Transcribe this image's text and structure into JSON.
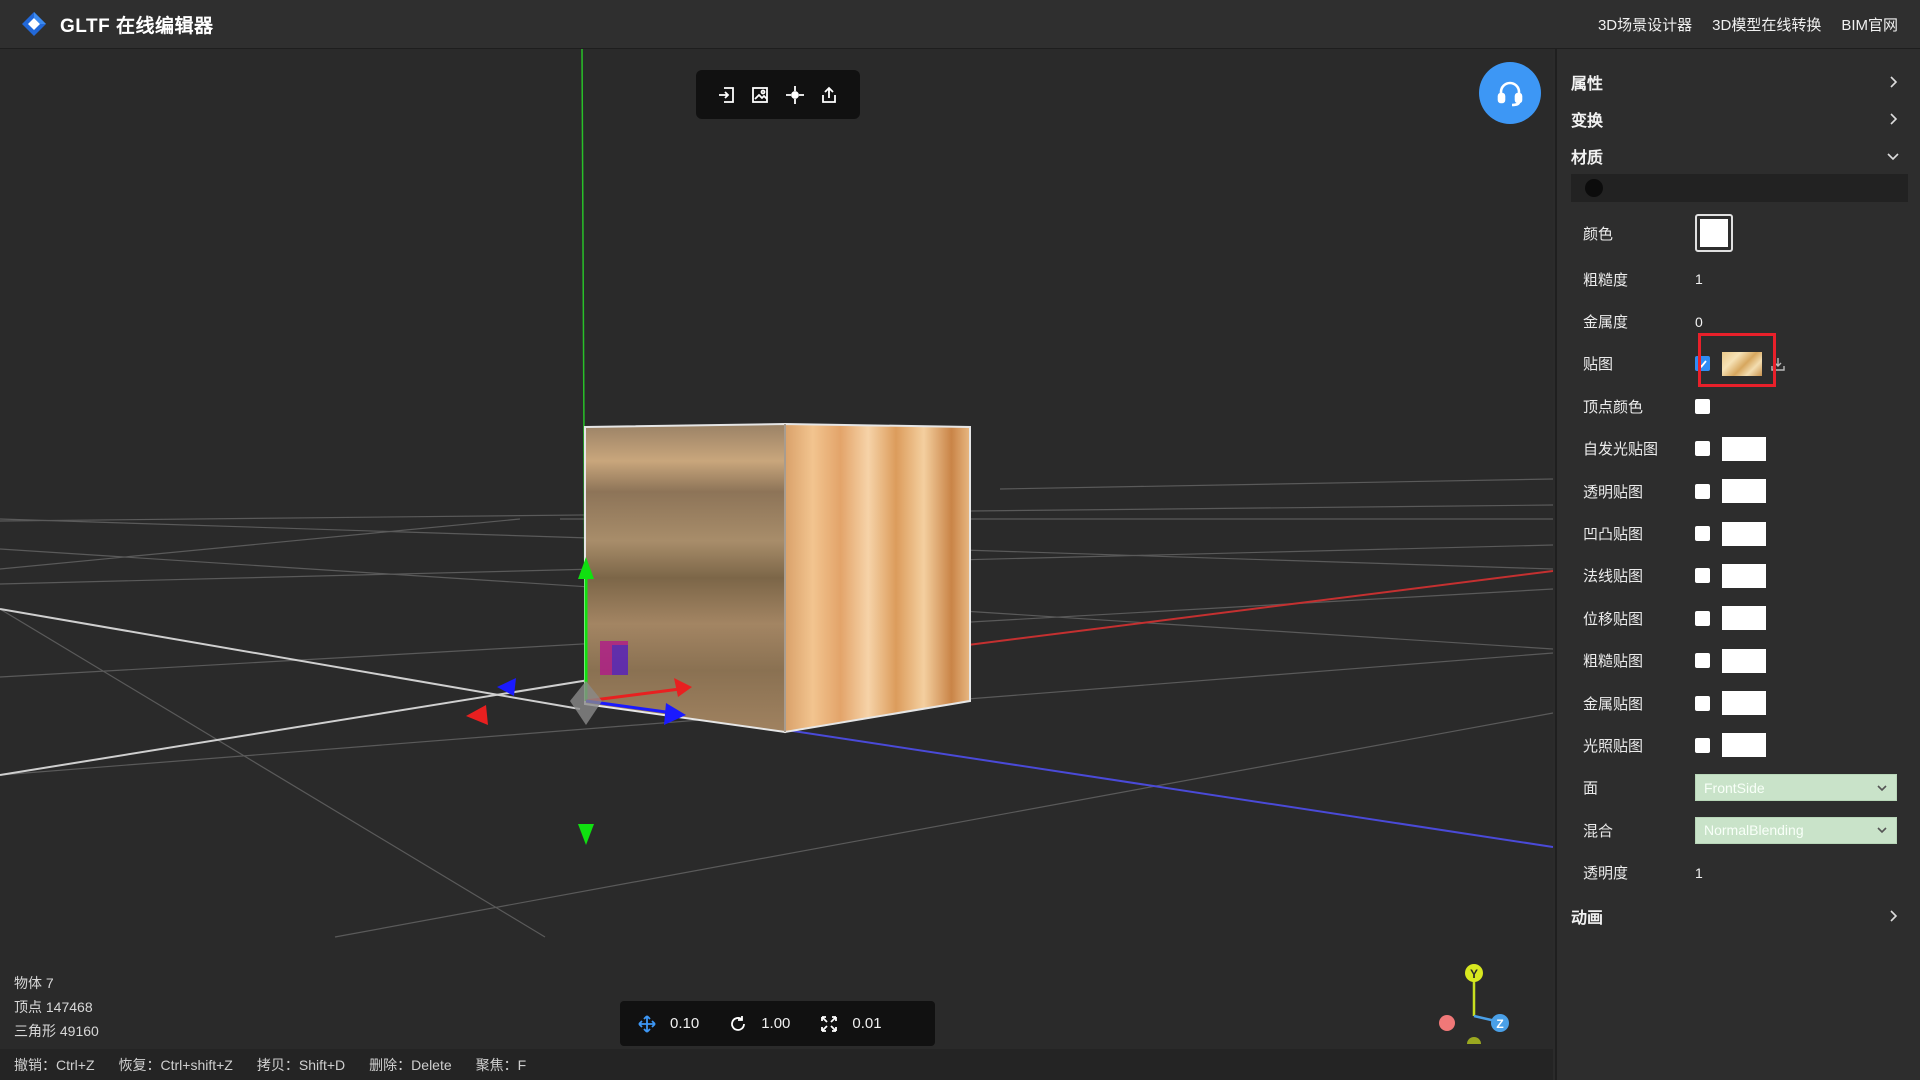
{
  "app": {
    "title": "GLTF 在线编辑器",
    "links": [
      "3D场景设计器",
      "3D模型在线转换",
      "BIM官网"
    ]
  },
  "stats": {
    "objects": "物体 7",
    "vertices": "顶点 147468",
    "triangles": "三角形 49160"
  },
  "snap": {
    "translate": "0.10",
    "rotate": "1.00",
    "scale": "0.01"
  },
  "shortcuts": [
    "撤销：Ctrl+Z",
    "恢复：Ctrl+shift+Z",
    "拷贝：Shift+D",
    "删除：Delete",
    "聚焦：F"
  ],
  "gizmo": {
    "x": "",
    "y": "Y",
    "z": "Z"
  },
  "panel": {
    "properties": "属性",
    "transform": "变换",
    "material": "材质",
    "animation": "动画",
    "rows": {
      "color": "颜色",
      "roughness_label": "粗糙度",
      "roughness": "1",
      "metalness_label": "金属度",
      "metalness": "0",
      "map": "贴图",
      "vertex_colors": "顶点颜色",
      "emissive_map": "自发光贴图",
      "alpha_map": "透明贴图",
      "bump_map": "凹凸贴图",
      "normal_map": "法线贴图",
      "displacement_map": "位移贴图",
      "roughness_map": "粗糙贴图",
      "metalness_map": "金属贴图",
      "light_map": "光照贴图",
      "side_label": "面",
      "side": "FrontSide",
      "blending_label": "混合",
      "blending": "NormalBlending",
      "opacity_label": "透明度",
      "opacity": "1"
    },
    "map_checked": true
  },
  "colors": {
    "accent": "#3d97f5",
    "checkbox": "#2f8cf5",
    "highlight": "#e8202a",
    "select_bg": "#c9e3c9"
  }
}
